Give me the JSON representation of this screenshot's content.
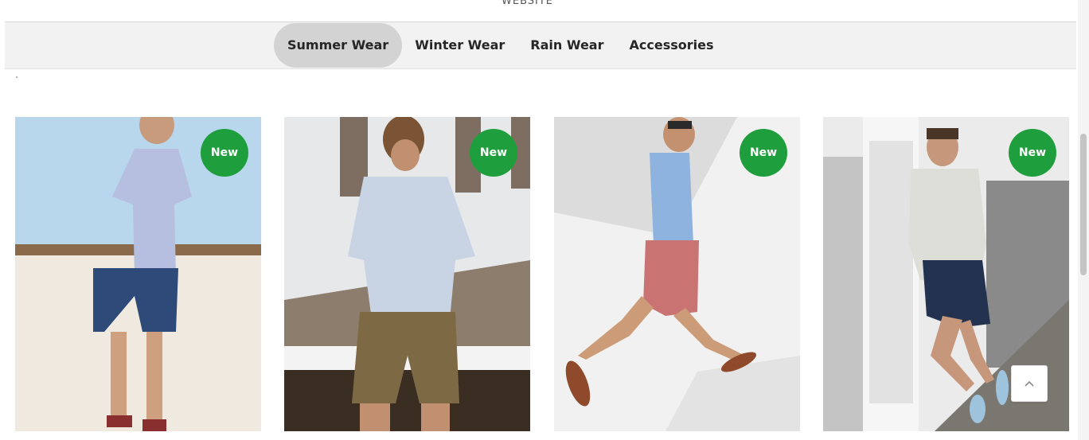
{
  "header": {
    "partial_title": "WEBSITE"
  },
  "tabs": [
    {
      "label": "Summer Wear",
      "active": true
    },
    {
      "label": "Winter Wear",
      "active": false
    },
    {
      "label": "Rain Wear",
      "active": false
    },
    {
      "label": "Accessories",
      "active": false
    }
  ],
  "products": [
    {
      "badge": "New"
    },
    {
      "badge": "New"
    },
    {
      "badge": "New"
    },
    {
      "badge": "New"
    }
  ],
  "colors": {
    "badge_green": "#1e9e3c",
    "tab_active_bg": "#d3d3d3",
    "tabbar_bg": "#f2f2f2"
  },
  "icons": {
    "back_to_top": "chevron-up-icon"
  }
}
